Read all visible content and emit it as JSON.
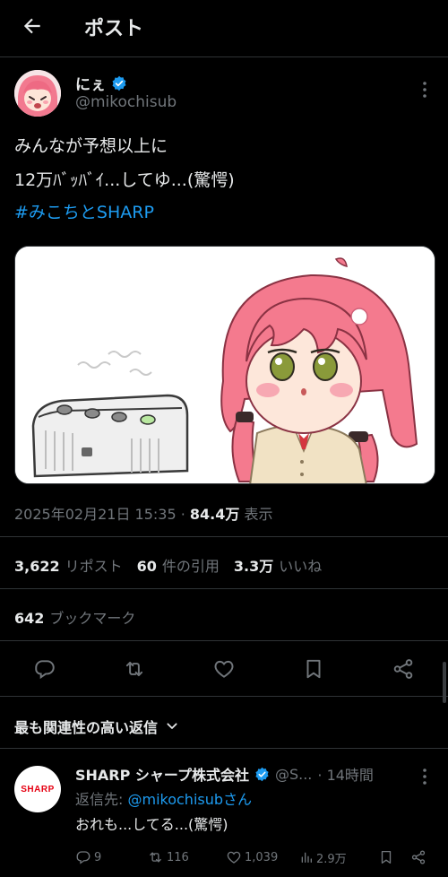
{
  "header": {
    "title": "ポスト"
  },
  "author": {
    "name": "にぇ",
    "handle": "@mikochisub"
  },
  "tweet": {
    "line1": "みんなが予想以上に",
    "line2": "12万ﾊﾞｯﾊﾞｲ...してゆ...(驚愕)",
    "hashtag": "#みこちとSHARP"
  },
  "meta": {
    "datetime": "2025年02月21日 15:35 · ",
    "views_num": "84.4万",
    "views_label": " 表示"
  },
  "stats": {
    "reposts_num": "3,622",
    "reposts_label": "リポスト",
    "quotes_num": "60",
    "quotes_label": "件の引用",
    "likes_num": "3.3万",
    "likes_label": "いいね",
    "bookmarks_num": "642",
    "bookmarks_label": "ブックマーク"
  },
  "icons": {
    "back": "arrow-left-icon",
    "more": "more-vertical-icon",
    "verified": "verified-badge-icon",
    "reply": "reply-icon",
    "repost": "repost-icon",
    "like": "heart-icon",
    "bookmark": "bookmark-icon",
    "share": "share-icon",
    "views": "views-icon",
    "chevron": "chevron-down-icon"
  },
  "sort": {
    "label": "最も関連性の高い返信"
  },
  "reply": {
    "name": "SHARP シャープ株式会社",
    "handle": "@S...",
    "time": "· 14時間",
    "reply_to_label": "返信先: ",
    "reply_to_handle": "@mikochisubさん",
    "text": "おれも...してる...(驚愕)",
    "logo_text": "SHARP",
    "replies": "9",
    "reposts": "116",
    "likes": "1,039",
    "views": "2.9万"
  },
  "colors": {
    "background": "#000000",
    "text": "#e7e9ea",
    "secondary": "#71767b",
    "accent": "#1d9bf0",
    "divider": "#2f3336",
    "sharp_red": "#e60012"
  }
}
